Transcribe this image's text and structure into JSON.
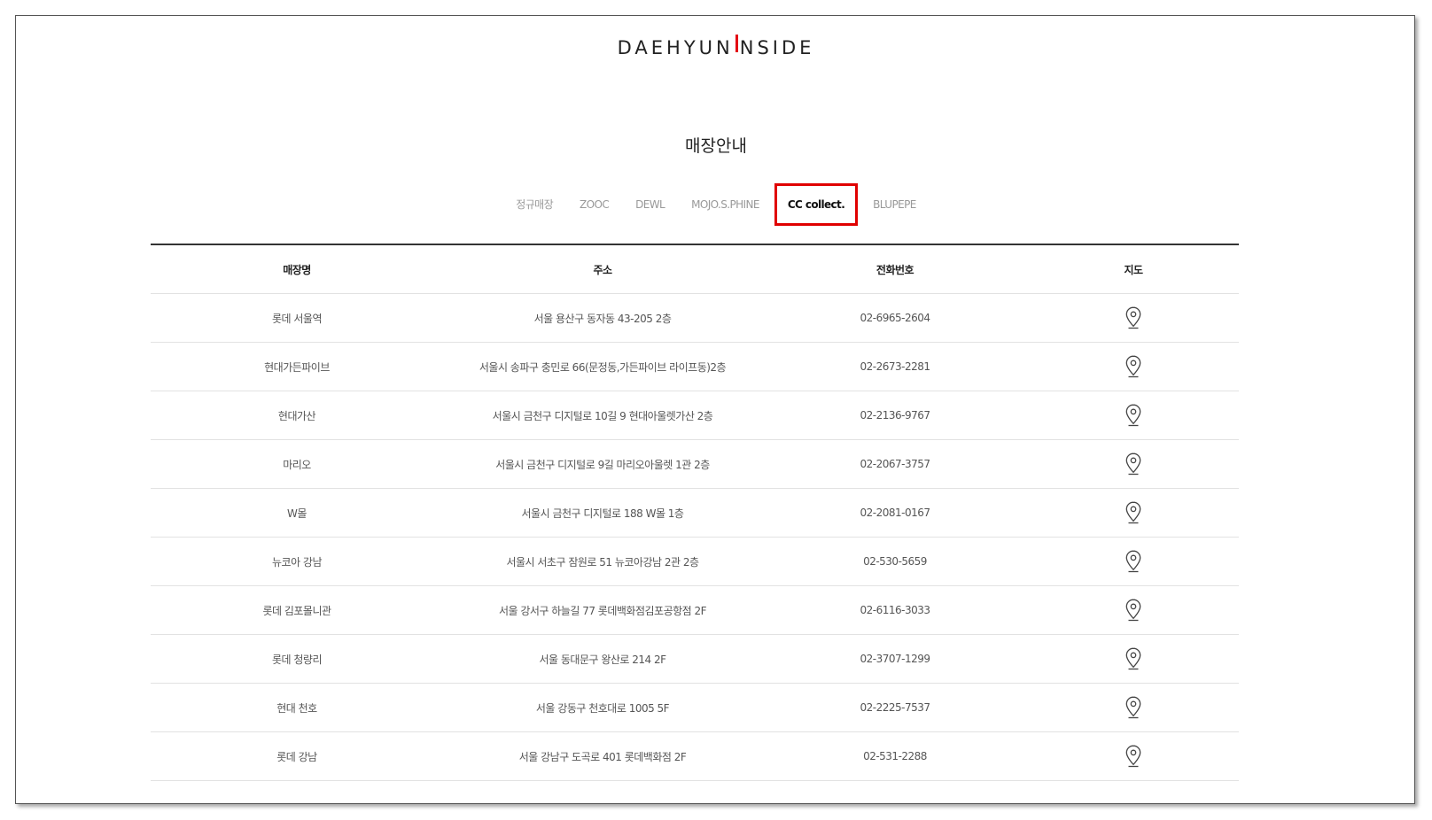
{
  "brand": {
    "left": "DAEHYUN",
    "right": "NSIDE",
    "accent": "#e30613"
  },
  "page_title": "매장안내",
  "tabs": [
    {
      "label": "정규매장",
      "active": false
    },
    {
      "label": "ZOOC",
      "active": false
    },
    {
      "label": "DEWL",
      "active": false
    },
    {
      "label": "MOJO.S.PHINE",
      "active": false
    },
    {
      "label": "CC collect.",
      "active": true
    },
    {
      "label": "BLUPEPE",
      "active": false
    }
  ],
  "table": {
    "headers": {
      "name": "매장명",
      "address": "주소",
      "phone": "전화번호",
      "map": "지도"
    },
    "rows": [
      {
        "name": "롯데 서울역",
        "address": "서울 용산구 동자동 43-205 2층",
        "phone": "02-6965-2604",
        "map_icon": "map-pin-icon"
      },
      {
        "name": "현대가든파이브",
        "address": "서울시 송파구 충민로 66(문정동,가든파이브 라이프동)2층",
        "phone": "02-2673-2281",
        "map_icon": "map-pin-icon"
      },
      {
        "name": "현대가산",
        "address": "서울시 금천구 디지털로 10길 9 현대아울렛가산 2층",
        "phone": "02-2136-9767",
        "map_icon": "map-pin-icon"
      },
      {
        "name": "마리오",
        "address": "서울시 금천구 디지털로 9길 마리오아울렛 1관 2층",
        "phone": "02-2067-3757",
        "map_icon": "map-pin-icon"
      },
      {
        "name": "W몰",
        "address": "서울시 금천구 디지털로 188 W몰 1층",
        "phone": "02-2081-0167",
        "map_icon": "map-pin-icon"
      },
      {
        "name": "뉴코아 강남",
        "address": "서울시 서초구 잠원로 51 뉴코아강남 2관 2층",
        "phone": "02-530-5659",
        "map_icon": "map-pin-icon"
      },
      {
        "name": "롯데 김포몰니관",
        "address": "서울 강서구 하늘길 77 롯데백화점김포공항점 2F",
        "phone": "02-6116-3033",
        "map_icon": "map-pin-icon"
      },
      {
        "name": "롯데 청량리",
        "address": "서울 동대문구 왕산로 214 2F",
        "phone": "02-3707-1299",
        "map_icon": "map-pin-icon"
      },
      {
        "name": "현대 천호",
        "address": "서울 강동구 천호대로 1005 5F",
        "phone": "02-2225-7537",
        "map_icon": "map-pin-icon"
      },
      {
        "name": "롯데 강남",
        "address": "서울 강남구 도곡로 401 롯데백화점 2F",
        "phone": "02-531-2288",
        "map_icon": "map-pin-icon"
      }
    ]
  }
}
